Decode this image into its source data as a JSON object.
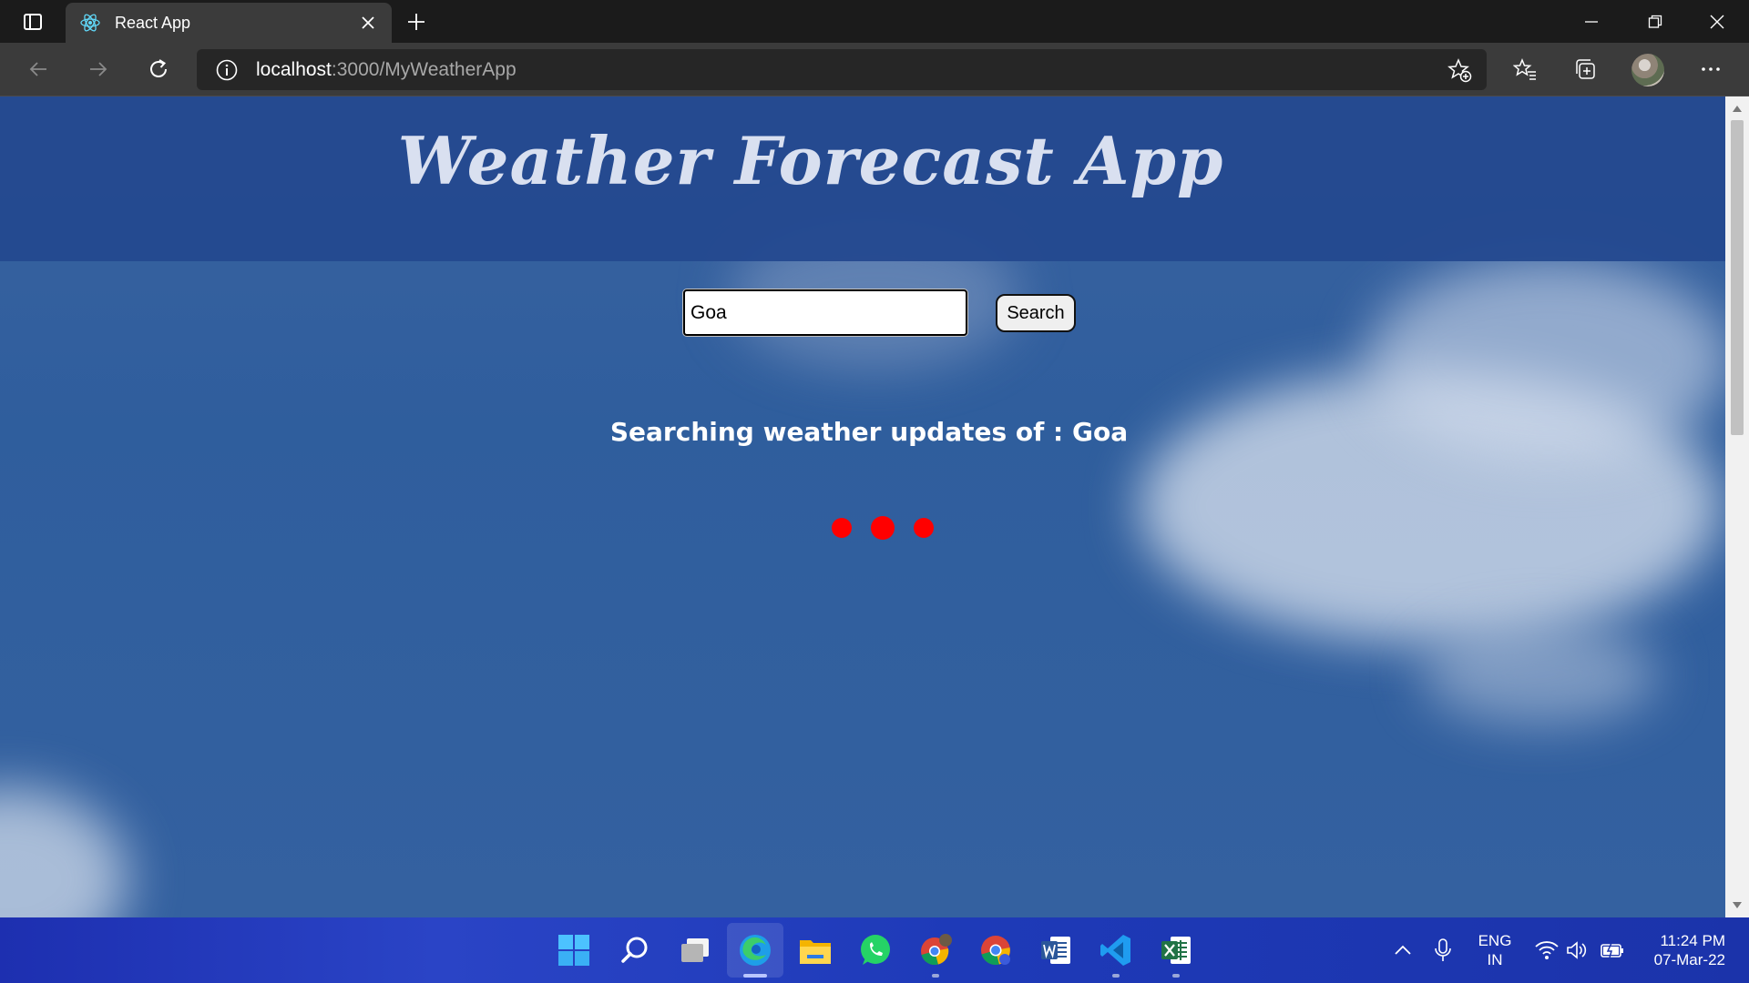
{
  "browser": {
    "tab": {
      "title": "React App",
      "favicon": "react-icon"
    },
    "url": {
      "host": "localhost",
      "rest": ":3000/MyWeatherApp"
    }
  },
  "app": {
    "title": "Weather Forecast App",
    "search": {
      "value": "Goa",
      "button_label": "Search"
    },
    "status_text": "Searching weather updates of : Goa",
    "loader_color": "#ff0000",
    "loading_dots": 3
  },
  "taskbar": {
    "apps": [
      "windows-start-icon",
      "search-icon",
      "task-view-icon",
      "edge-icon",
      "file-explorer-icon",
      "whatsapp-icon",
      "chrome-profile-icon",
      "chrome-icon",
      "word-icon",
      "vscode-icon",
      "excel-icon"
    ],
    "language": {
      "line1": "ENG",
      "line2": "IN"
    },
    "time": "11:24 PM",
    "date": "07-Mar-22"
  },
  "colors": {
    "header_band": "#24498f",
    "page_background": "#3461a0",
    "taskbar": "#2a44c6"
  }
}
